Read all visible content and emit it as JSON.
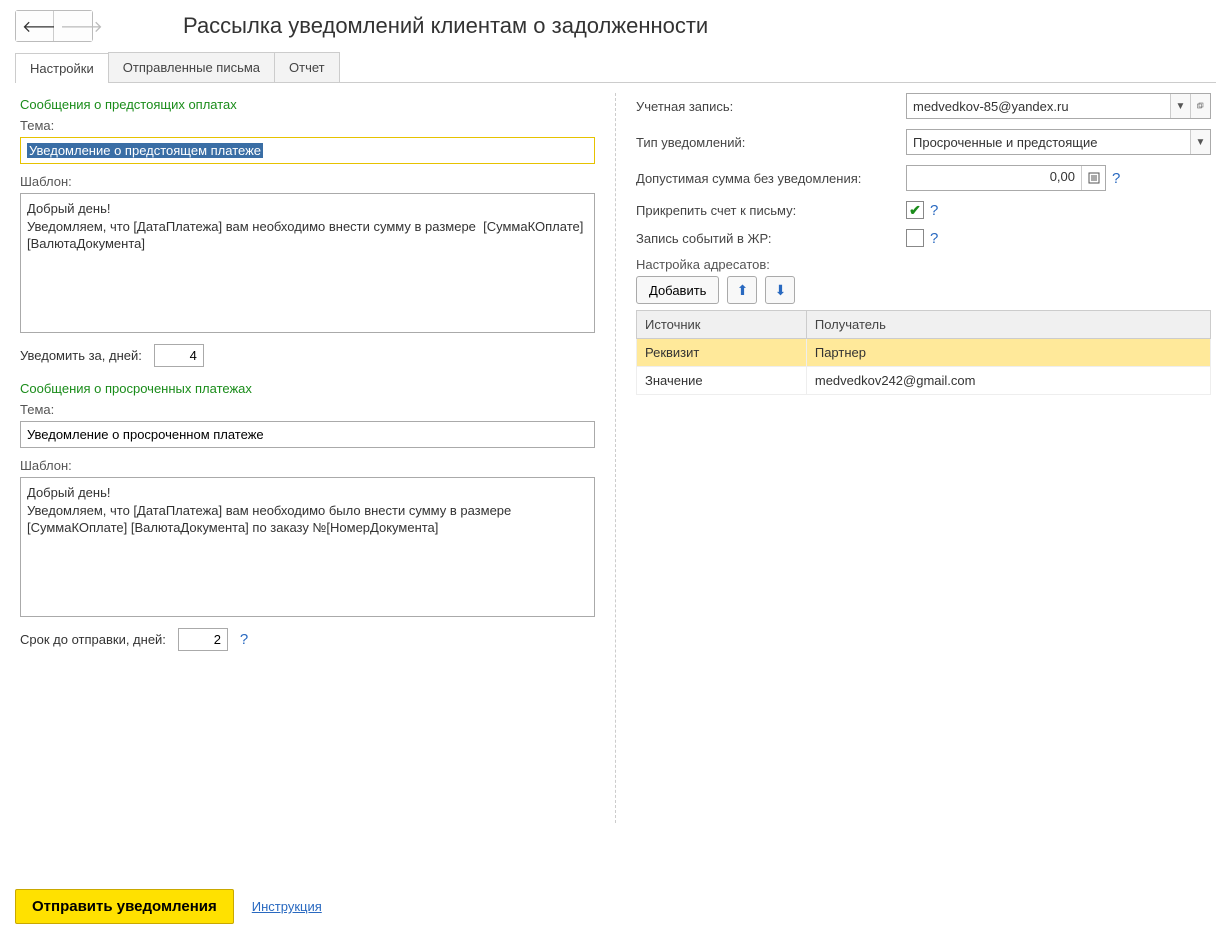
{
  "header": {
    "title": "Рассылка уведомлений клиентам о задолженности"
  },
  "tabs": {
    "settings": "Настройки",
    "sent": "Отправленные письма",
    "report": "Отчет"
  },
  "left": {
    "upcoming_section": "Сообщения о предстоящих оплатах",
    "subject_label": "Тема:",
    "upcoming_subject": "Уведомление о предстоящем платеже",
    "template_label": "Шаблон:",
    "upcoming_template": "Добрый день!\nУведомляем, что [ДатаПлатежа] вам необходимо внести сумму в размере  [СуммаКОплате] [ВалютаДокумента]",
    "notify_days_label": "Уведомить за, дней:",
    "notify_days": "4",
    "overdue_section": "Сообщения о просроченных платежах",
    "overdue_subject": "Уведомление о просроченном платеже",
    "overdue_template": "Добрый день!\nУведомляем, что [ДатаПлатежа] вам необходимо было внести сумму в размере  [СуммаКОплате] [ВалютаДокумента] по заказу №[НомерДокумента]",
    "send_due_label": "Срок до отправки, дней:",
    "send_due_days": "2"
  },
  "right": {
    "account_label": "Учетная запись:",
    "account_value": "medvedkov-85@yandex.ru",
    "notif_type_label": "Тип уведомлений:",
    "notif_type_value": "Просроченные и предстоящие",
    "allowed_sum_label": "Допустимая сумма без уведомления:",
    "allowed_sum_value": "0,00",
    "attach_label": "Прикрепить счет к письму:",
    "log_label": "Запись событий в ЖР:",
    "recipients_label": "Настройка адресатов:",
    "add_button": "Добавить",
    "table": {
      "col_source": "Источник",
      "col_recipient": "Получатель",
      "r1_source": "Реквизит",
      "r1_recipient": "Партнер",
      "r2_source": "Значение",
      "r2_recipient": "medvedkov242@gmail.com"
    }
  },
  "footer": {
    "send_button": "Отправить уведомления",
    "instruction_link": "Инструкция"
  }
}
